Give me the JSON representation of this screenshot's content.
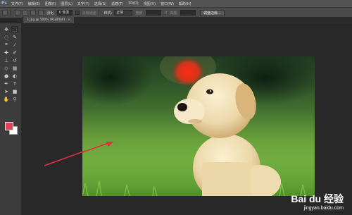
{
  "app": {
    "logo": "Ps"
  },
  "menu": [
    "文件(F)",
    "编辑(E)",
    "图像(I)",
    "图层(L)",
    "文字(Y)",
    "选择(S)",
    "滤镜(T)",
    "3D(D)",
    "视图(V)",
    "窗口(W)",
    "帮助(H)"
  ],
  "options": {
    "feather_label": "羽化:",
    "feather_value": "0 像素",
    "antialias_label": "消除锯齿",
    "style_label": "样式:",
    "style_value": "正常",
    "width_label": "宽度:",
    "height_label": "高度:",
    "refine_edge_label": "调整边缘..."
  },
  "document": {
    "tab_title": "1.jpg @ 100% (RGB/8#)",
    "close_symbol": "×"
  },
  "colors": {
    "foreground": "#e04258",
    "background": "#ffffff",
    "arrow": "#e0323c"
  },
  "tools": [
    "move-tool-icon",
    "marquee-tool-icon",
    "lasso-tool-icon",
    "quick-select-tool-icon",
    "crop-tool-icon",
    "eyedropper-tool-icon",
    "healing-tool-icon",
    "brush-tool-icon",
    "clone-stamp-tool-icon",
    "history-brush-tool-icon",
    "eraser-tool-icon",
    "gradient-tool-icon",
    "blur-tool-icon",
    "dodge-tool-icon",
    "pen-tool-icon",
    "type-tool-icon",
    "path-select-tool-icon",
    "shape-tool-icon",
    "hand-tool-icon",
    "zoom-tool-icon"
  ],
  "watermark": {
    "line1": "Bai du 经验",
    "line2": "jingyan.baidu.com"
  }
}
